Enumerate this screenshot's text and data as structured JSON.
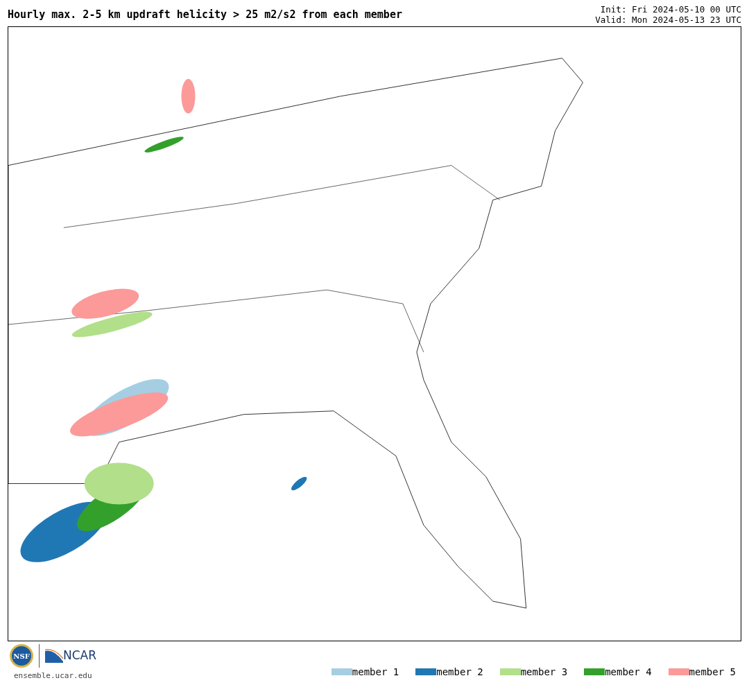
{
  "header": {
    "title": "Hourly max. 2-5 km updraft helicity > 25 m2/s2 from each member",
    "init": "Init: Fri 2024-05-10 00 UTC",
    "valid": "Valid: Mon 2024-05-13 23 UTC"
  },
  "footer": {
    "logo_nsf": "NSF",
    "logo_ncar": "NCAR",
    "site": "ensemble.ucar.edu"
  },
  "legend": [
    {
      "label": "member 1",
      "color": "#a6cee3"
    },
    {
      "label": "member 2",
      "color": "#1f78b4"
    },
    {
      "label": "member 3",
      "color": "#b2df8a"
    },
    {
      "label": "member 4",
      "color": "#33a02c"
    },
    {
      "label": "member 5",
      "color": "#fb9a99"
    }
  ]
}
